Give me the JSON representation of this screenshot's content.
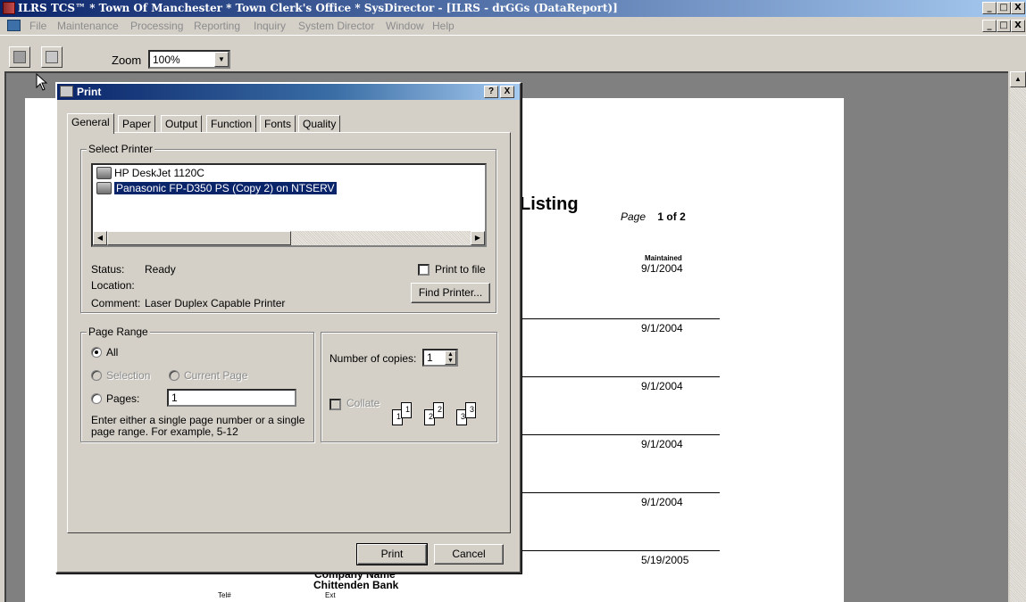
{
  "window": {
    "title": "ILRS TCS™ * Town Of Manchester * Town Clerk's Office * SysDirector - [ILRS - drGGs (DataReport)]",
    "controls": [
      "_",
      "□",
      "X"
    ]
  },
  "menubar": {
    "items": [
      "File",
      "Maintenance",
      "Processing",
      "Reporting",
      "Inquiry",
      "System Director",
      "Window",
      "Help"
    ]
  },
  "toolbar": {
    "zoom_label": "Zoom",
    "zoom_value": "100%"
  },
  "report": {
    "title": "Listing",
    "page_prefix": "Page",
    "page_num": "1",
    "page_of": "of",
    "page_total": "2",
    "maint_label": "Maintained",
    "dates": [
      "9/1/2004",
      "9/1/2004",
      "9/1/2004",
      "9/1/2004",
      "9/1/2004",
      "5/19/2005"
    ],
    "company_partial": "Company Name",
    "company": "Chittenden Bank",
    "tel_label": "Tel#",
    "ext_label": "Ext"
  },
  "print_dialog": {
    "title": "Print",
    "help_btn": "?",
    "close_btn": "X",
    "tabs": [
      "General",
      "Paper",
      "Output",
      "Function",
      "Fonts",
      "Quality"
    ],
    "active_tab": "General",
    "select_printer": {
      "legend": "Select Printer",
      "printers": [
        {
          "name": "HP DeskJet 1120C",
          "selected": false
        },
        {
          "name": "Panasonic FP-D350 PS (Copy 2) on NTSERV",
          "selected": true
        }
      ],
      "status_label": "Status:",
      "status_value": "Ready",
      "location_label": "Location:",
      "location_value": "",
      "comment_label": "Comment:",
      "comment_value": "Laser Duplex Capable Printer",
      "print_to_file": "Print to file",
      "print_to_file_checked": false,
      "find_printer": "Find Printer..."
    },
    "page_range": {
      "legend": "Page Range",
      "all": "All",
      "selection": "Selection",
      "current_page": "Current Page",
      "pages": "Pages:",
      "pages_value": "1",
      "hint": "Enter either a single page number or a single page range.  For example, 5-12",
      "selected": "All"
    },
    "copies": {
      "label": "Number of copies:",
      "value": "1",
      "collate": "Collate",
      "collate_checked": false,
      "icon_labels": [
        "1",
        "1",
        "2",
        "2",
        "3",
        "3"
      ]
    },
    "print_btn": "Print",
    "cancel_btn": "Cancel"
  }
}
